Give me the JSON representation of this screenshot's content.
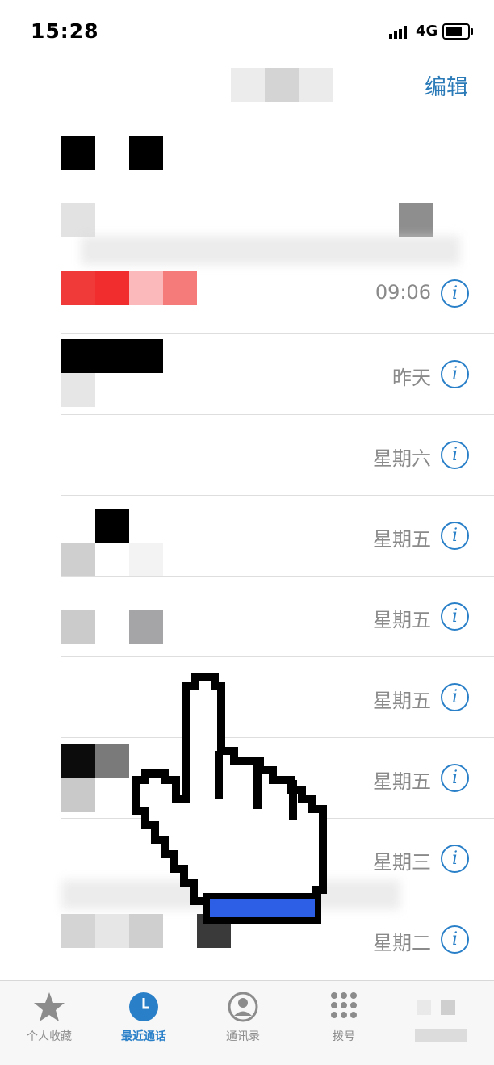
{
  "status_bar": {
    "time": "15:28",
    "network": "4G"
  },
  "nav": {
    "edit_label": "编辑"
  },
  "calls": [
    {
      "date": "09:06"
    },
    {
      "date": "昨天"
    },
    {
      "date": "星期六"
    },
    {
      "date": "星期五"
    },
    {
      "date": "星期五"
    },
    {
      "date": "星期五"
    },
    {
      "date": "星期五"
    },
    {
      "date": "星期三"
    },
    {
      "date": "星期二"
    }
  ],
  "tabs": [
    {
      "label": "个人收藏",
      "icon": "star-icon"
    },
    {
      "label": "最近通话",
      "icon": "clock-icon",
      "active": true
    },
    {
      "label": "通讯录",
      "icon": "person-icon"
    },
    {
      "label": "拨号",
      "icon": "keypad-icon"
    },
    {
      "label": "",
      "icon": "voicemail-icon"
    }
  ],
  "colors": {
    "accent": "#2a80c8",
    "missed_call": "#f23a3a"
  }
}
